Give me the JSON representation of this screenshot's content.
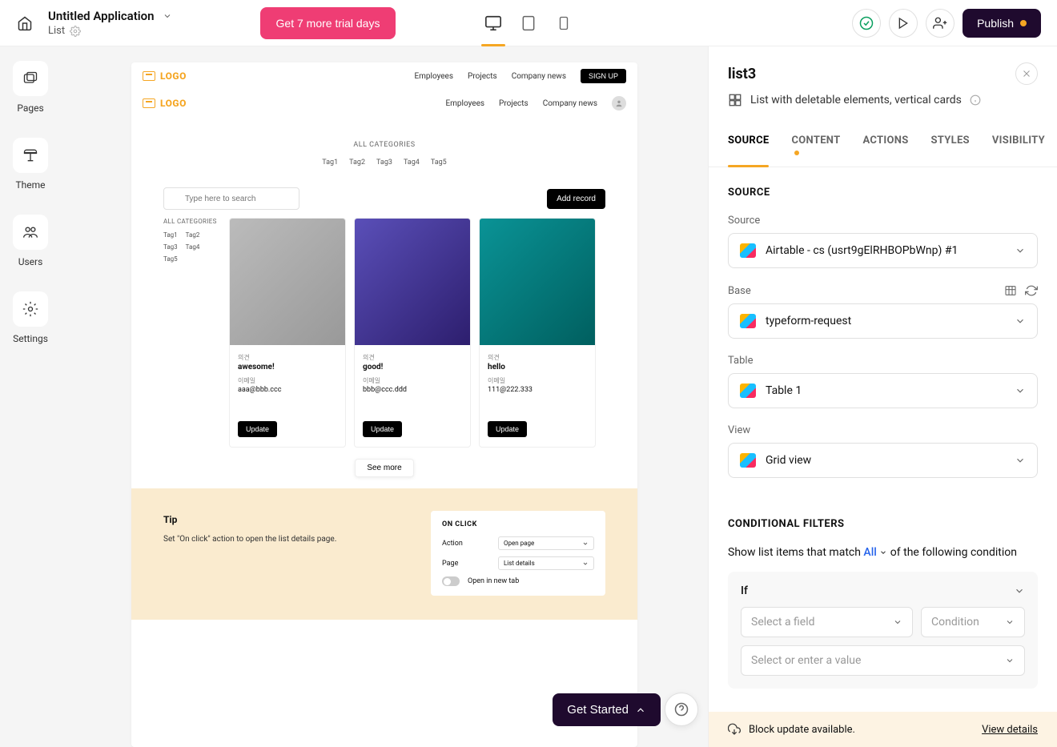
{
  "topbar": {
    "app_title": "Untitled Application",
    "sub_label": "List",
    "trial_btn": "Get 7 more trial days",
    "publish": "Publish"
  },
  "sidebar": {
    "items": [
      {
        "label": "Pages"
      },
      {
        "label": "Theme"
      },
      {
        "label": "Users"
      },
      {
        "label": "Settings"
      }
    ]
  },
  "page_preview": {
    "nav1": {
      "items": [
        "Employees",
        "Projects",
        "Company news"
      ],
      "signup": "SIGN UP"
    },
    "nav2": {
      "items": [
        "Employees",
        "Projects",
        "Company news"
      ]
    },
    "logo": "LOGO",
    "all_categories": "ALL CATEGORIES",
    "tags": [
      "Tag1",
      "Tag2",
      "Tag3",
      "Tag4",
      "Tag5"
    ],
    "search_placeholder": "Type here to search",
    "add_record": "Add record",
    "filter_title": "ALL CATEGORIES",
    "filter_tags": [
      "Tag1",
      "Tag2",
      "Tag3",
      "Tag4",
      "Tag5"
    ],
    "cards": [
      {
        "l1": "의견",
        "v1": "awesome!",
        "l2": "이메일",
        "v2": "aaa@bbb.ccc",
        "btn": "Update"
      },
      {
        "l1": "의견",
        "v1": "good!",
        "l2": "이메일",
        "v2": "bbb@ccc.ddd",
        "btn": "Update"
      },
      {
        "l1": "의견",
        "v1": "hello",
        "l2": "이메일",
        "v2": "111@222.333",
        "btn": "Update"
      }
    ],
    "see_more": "See more",
    "tip_title": "Tip",
    "tip_text": "Set \"On click\" action to open the list details page.",
    "onclick_card": {
      "title": "ON CLICK",
      "action_lbl": "Action",
      "action_val": "Open page",
      "page_lbl": "Page",
      "page_val": "List details",
      "open_new_tab": "Open in new tab"
    }
  },
  "right": {
    "title": "list3",
    "subtitle": "List with deletable elements, vertical cards",
    "tabs": [
      "SOURCE",
      "CONTENT",
      "ACTIONS",
      "STYLES",
      "VISIBILITY"
    ],
    "source_header": "SOURCE",
    "source_label": "Source",
    "source_value": "Airtable - cs (usrt9gElRHBOPbWnp) #1",
    "base_label": "Base",
    "base_value": "typeform-request",
    "table_label": "Table",
    "table_value": "Table 1",
    "view_label": "View",
    "view_value": "Grid view",
    "cond_header": "CONDITIONAL FILTERS",
    "cond_text_prefix": "Show list items that match ",
    "cond_all": "All",
    "cond_text_suffix": " of the following condition",
    "cond_if": "If",
    "cond_field_ph": "Select a field",
    "cond_cond_ph": "Condition",
    "cond_value_ph": "Select or enter a value",
    "notice": "Block update available.",
    "notice_link": "View details"
  },
  "floating": {
    "get_started": "Get Started"
  }
}
